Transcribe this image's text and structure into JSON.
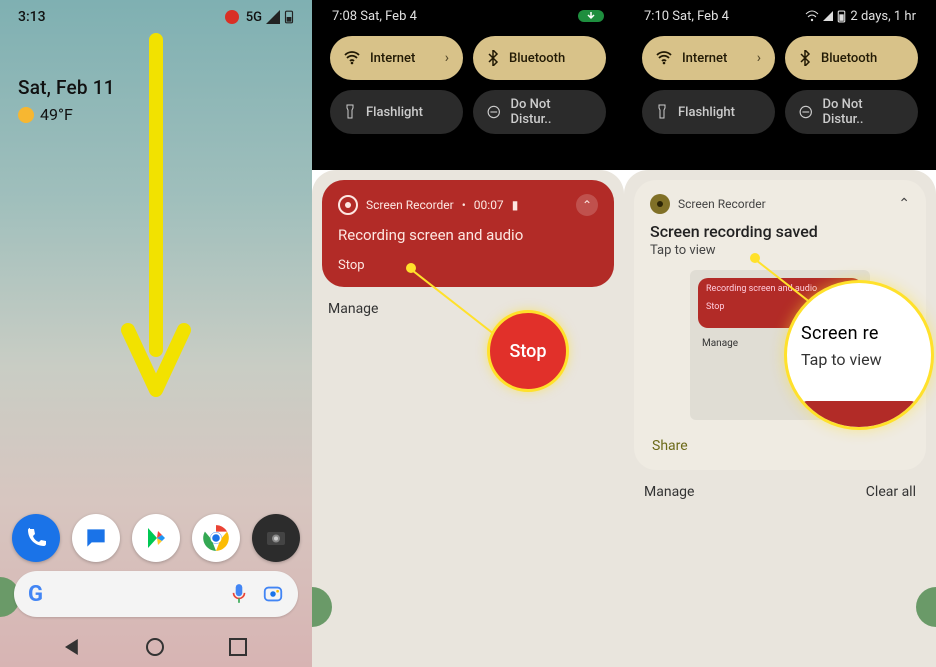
{
  "panel1": {
    "status_time": "3:13",
    "status_right": "5G",
    "date": "Sat, Feb 11",
    "temp": "49°F",
    "dock": [
      "Phone",
      "Messages",
      "Play Store",
      "Chrome",
      "Camera"
    ]
  },
  "panel2": {
    "status_time": "7:08  Sat, Feb 4",
    "tiles": {
      "internet": "Internet",
      "bluetooth": "Bluetooth",
      "flashlight": "Flashlight",
      "dnd": "Do Not Distur.."
    },
    "header": "Screen Recorder",
    "elapsed": "00:07",
    "title": "Recording screen and audio",
    "stop": "Stop",
    "manage": "Manage",
    "big_stop": "Stop"
  },
  "panel3": {
    "status_time": "7:10  Sat, Feb 4",
    "status_right": "2 days, 1 hr",
    "tiles": {
      "internet": "Internet",
      "bluetooth": "Bluetooth",
      "flashlight": "Flashlight",
      "dnd": "Do Not Distur.."
    },
    "header": "Screen Recorder",
    "title": "Screen recording saved",
    "sub": "Tap to view",
    "thumb_title": "Recording screen and audio",
    "thumb_stop": "Stop",
    "thumb_manage": "Manage",
    "share": "Share",
    "manage": "Manage",
    "clear": "Clear all",
    "mag_l1": "Screen re",
    "mag_l2": "Tap to view"
  }
}
